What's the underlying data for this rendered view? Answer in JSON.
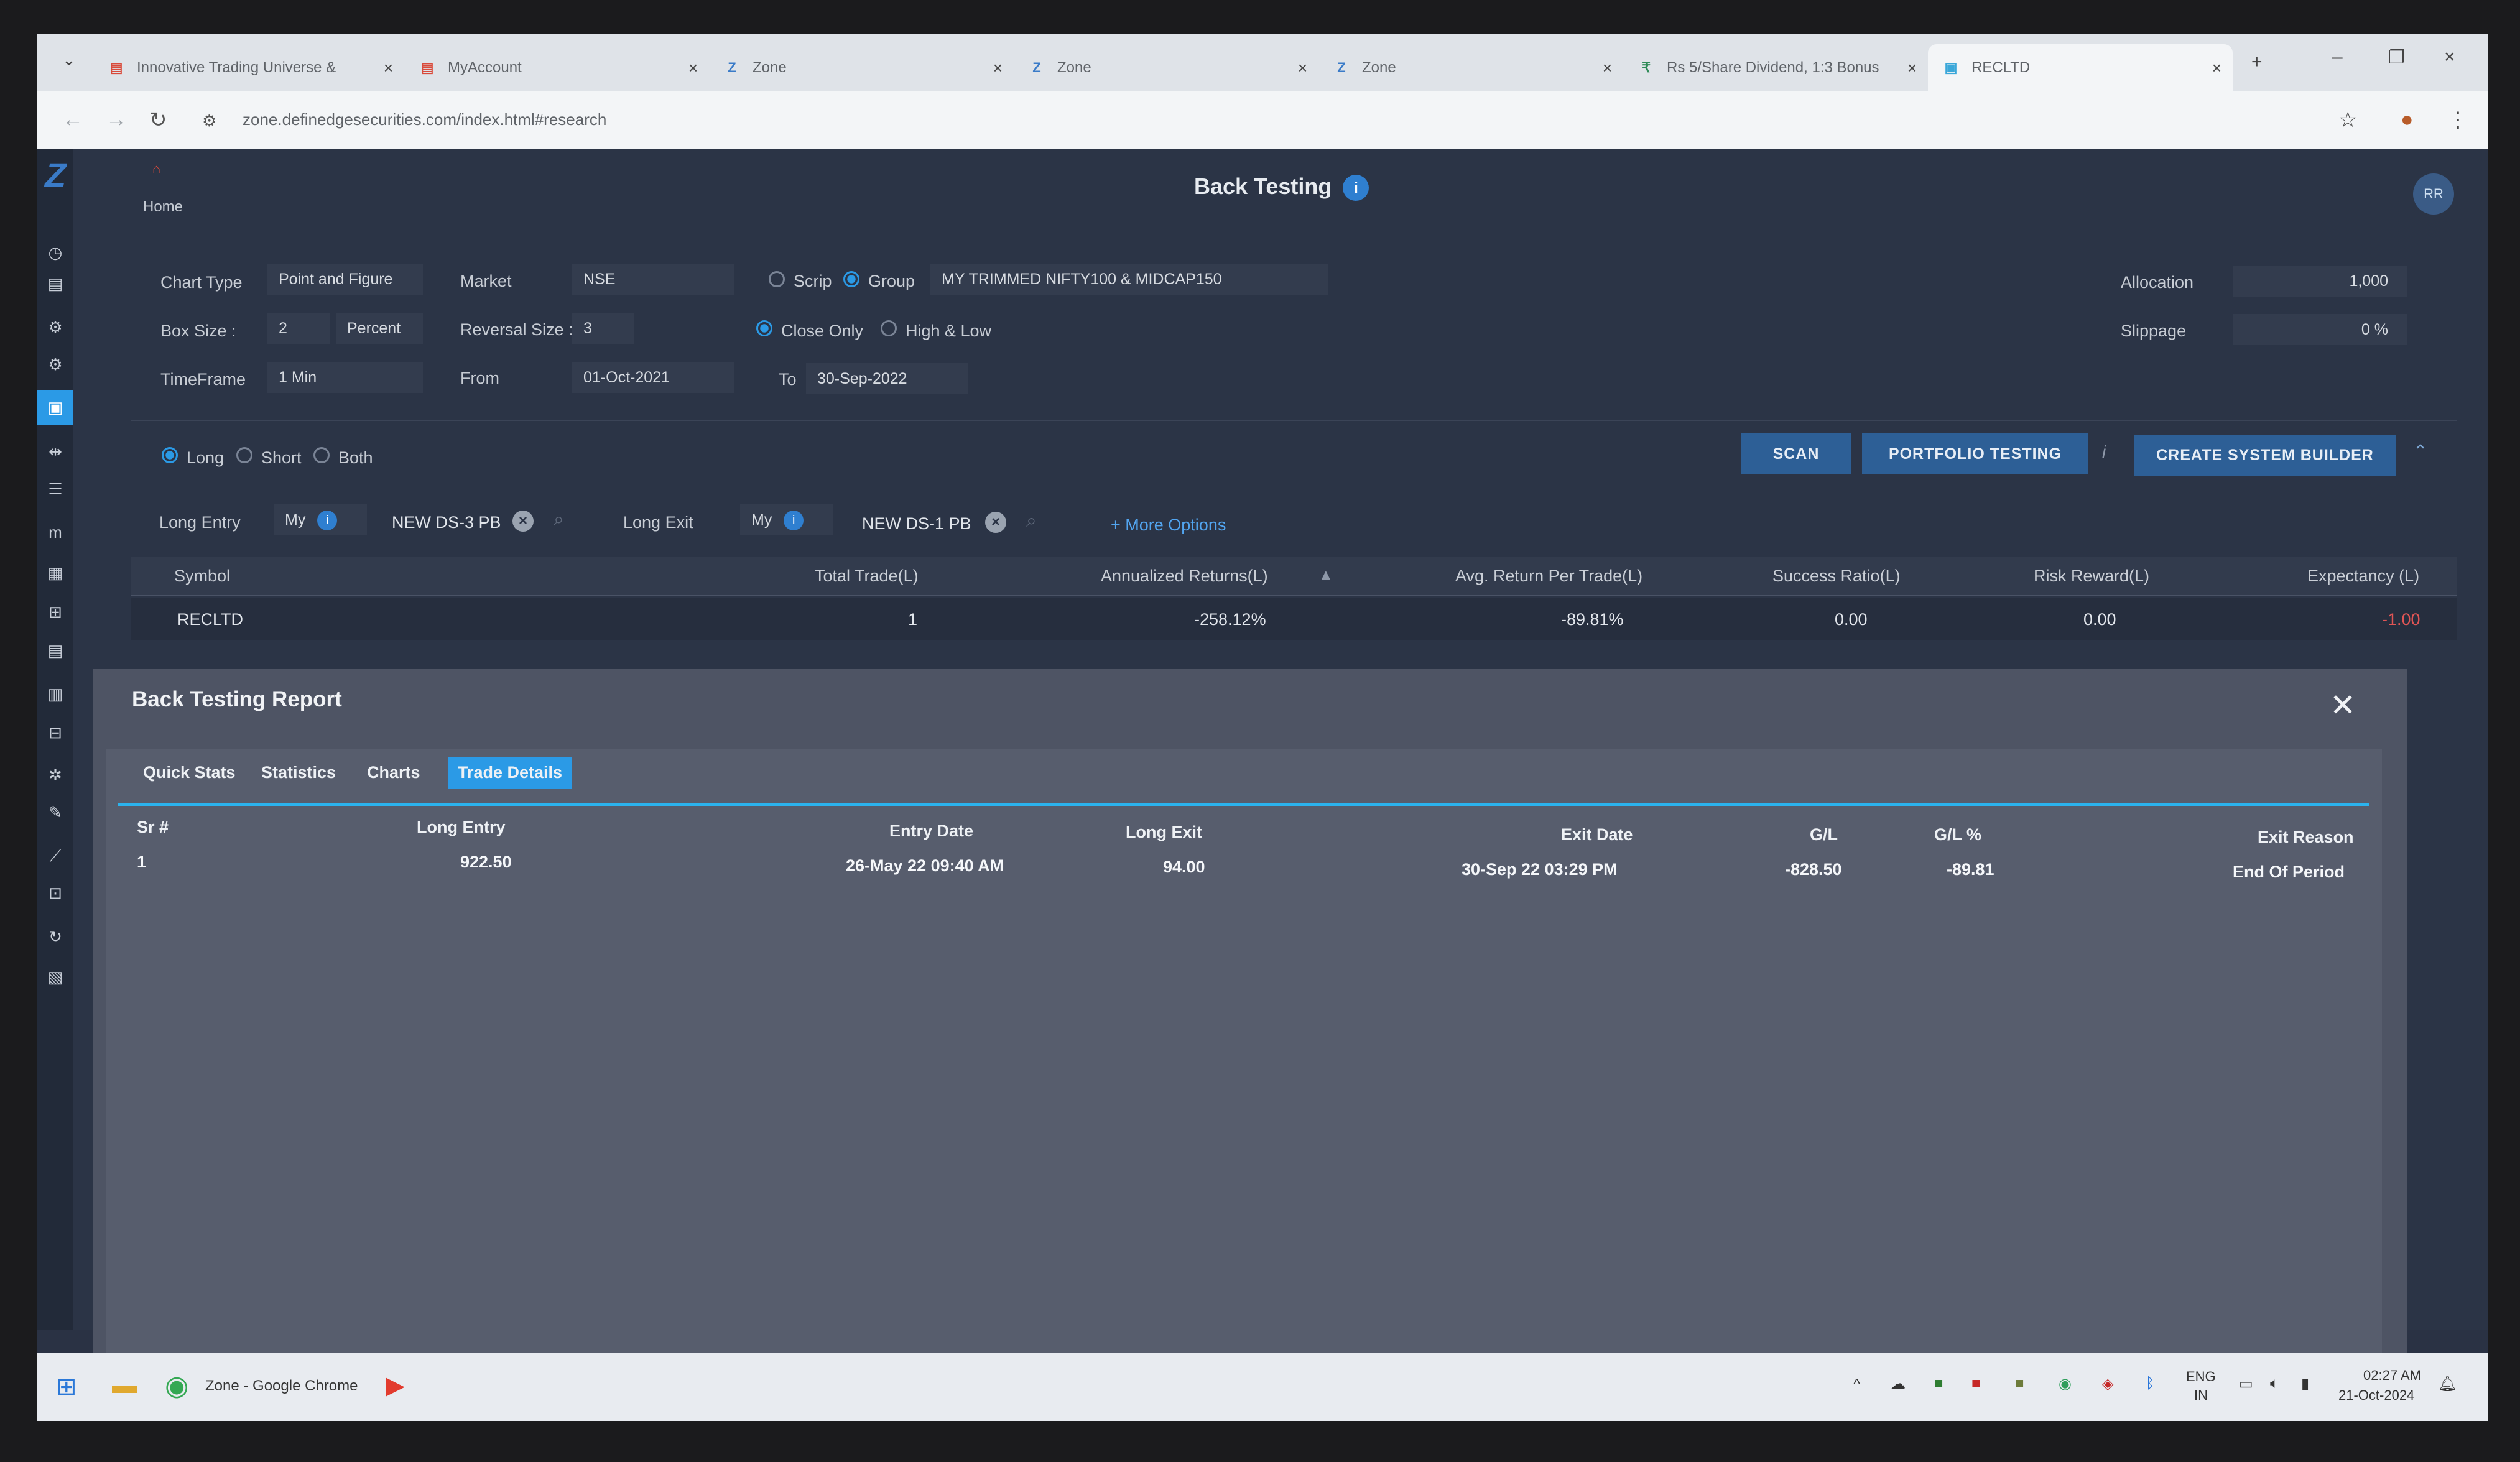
{
  "browser": {
    "tabs": [
      {
        "title": "Innovative Trading Universe &",
        "fav": "▤",
        "color": "#d94a3a"
      },
      {
        "title": "MyAccount",
        "fav": "▤",
        "color": "#d94a3a"
      },
      {
        "title": "Zone",
        "fav": "Z",
        "color": "#3a7bc8"
      },
      {
        "title": "Zone",
        "fav": "Z",
        "color": "#3a7bc8"
      },
      {
        "title": "Zone",
        "fav": "Z",
        "color": "#3a7bc8"
      },
      {
        "title": "Rs 5/Share Dividend, 1:3 Bonus",
        "fav": "₹",
        "color": "#2e8b57"
      },
      {
        "title": "RECLTD",
        "fav": "▣",
        "color": "#3aa7d9"
      }
    ],
    "url": "zone.definedgesecurities.com/index.html#research"
  },
  "app": {
    "home_label": "Home",
    "page_title": "Back Testing",
    "avatar": "RR",
    "form": {
      "chart_type_label": "Chart Type",
      "chart_type": "Point and Figure",
      "market_label": "Market",
      "market": "NSE",
      "scrip_label": "Scrip",
      "group_label": "Group",
      "group_value": "MY TRIMMED NIFTY100 & MIDCAP150",
      "box_size_label": "Box Size :",
      "box_size": "2",
      "box_unit": "Percent",
      "reversal_label": "Reversal Size :",
      "reversal": "3",
      "close_only": "Close Only",
      "high_low": "High & Low",
      "timeframe_label": "TimeFrame",
      "timeframe": "1 Min",
      "from_label": "From",
      "from": "01-Oct-2021",
      "to_label": "To",
      "to": "30-Sep-2022",
      "allocation_label": "Allocation",
      "allocation": "1,000",
      "slippage_label": "Slippage",
      "slippage": "0 %",
      "long": "Long",
      "short": "Short",
      "both": "Both",
      "long_entry_label": "Long Entry",
      "my": "My",
      "entry_strategy": "NEW DS-3 PB",
      "long_exit_label": "Long Exit",
      "exit_strategy": "NEW DS-1 PB",
      "more_options": "+ More Options"
    },
    "buttons": {
      "scan": "SCAN",
      "portfolio": "PORTFOLIO TESTING",
      "create": "CREATE SYSTEM BUILDER"
    },
    "results": {
      "headers": [
        "Symbol",
        "Total Trade(L)",
        "Annualized Returns(L)",
        "Avg. Return Per Trade(L)",
        "Success Ratio(L)",
        "Risk Reward(L)",
        "Expectancy (L)"
      ],
      "row": [
        "RECLTD",
        "1",
        "-258.12%",
        "-89.81%",
        "0.00",
        "0.00",
        "-1.00"
      ]
    }
  },
  "modal": {
    "title": "Back Testing Report",
    "tabs": [
      "Quick Stats",
      "Statistics",
      "Charts",
      "Trade Details"
    ],
    "headers": [
      "Sr #",
      "Long Entry",
      "Entry Date",
      "Long Exit",
      "Exit Date",
      "G/L",
      "G/L %",
      "Exit Reason"
    ],
    "row": [
      "1",
      "922.50",
      "26-May 22 09:40 AM",
      "94.00",
      "30-Sep 22 03:29 PM",
      "-828.50",
      "-89.81",
      "End Of Period"
    ]
  },
  "taskbar": {
    "app_label": "Zone - Google Chrome",
    "lang": "ENG",
    "region": "IN",
    "time": "02:27 AM",
    "date": "21-Oct-2024"
  }
}
